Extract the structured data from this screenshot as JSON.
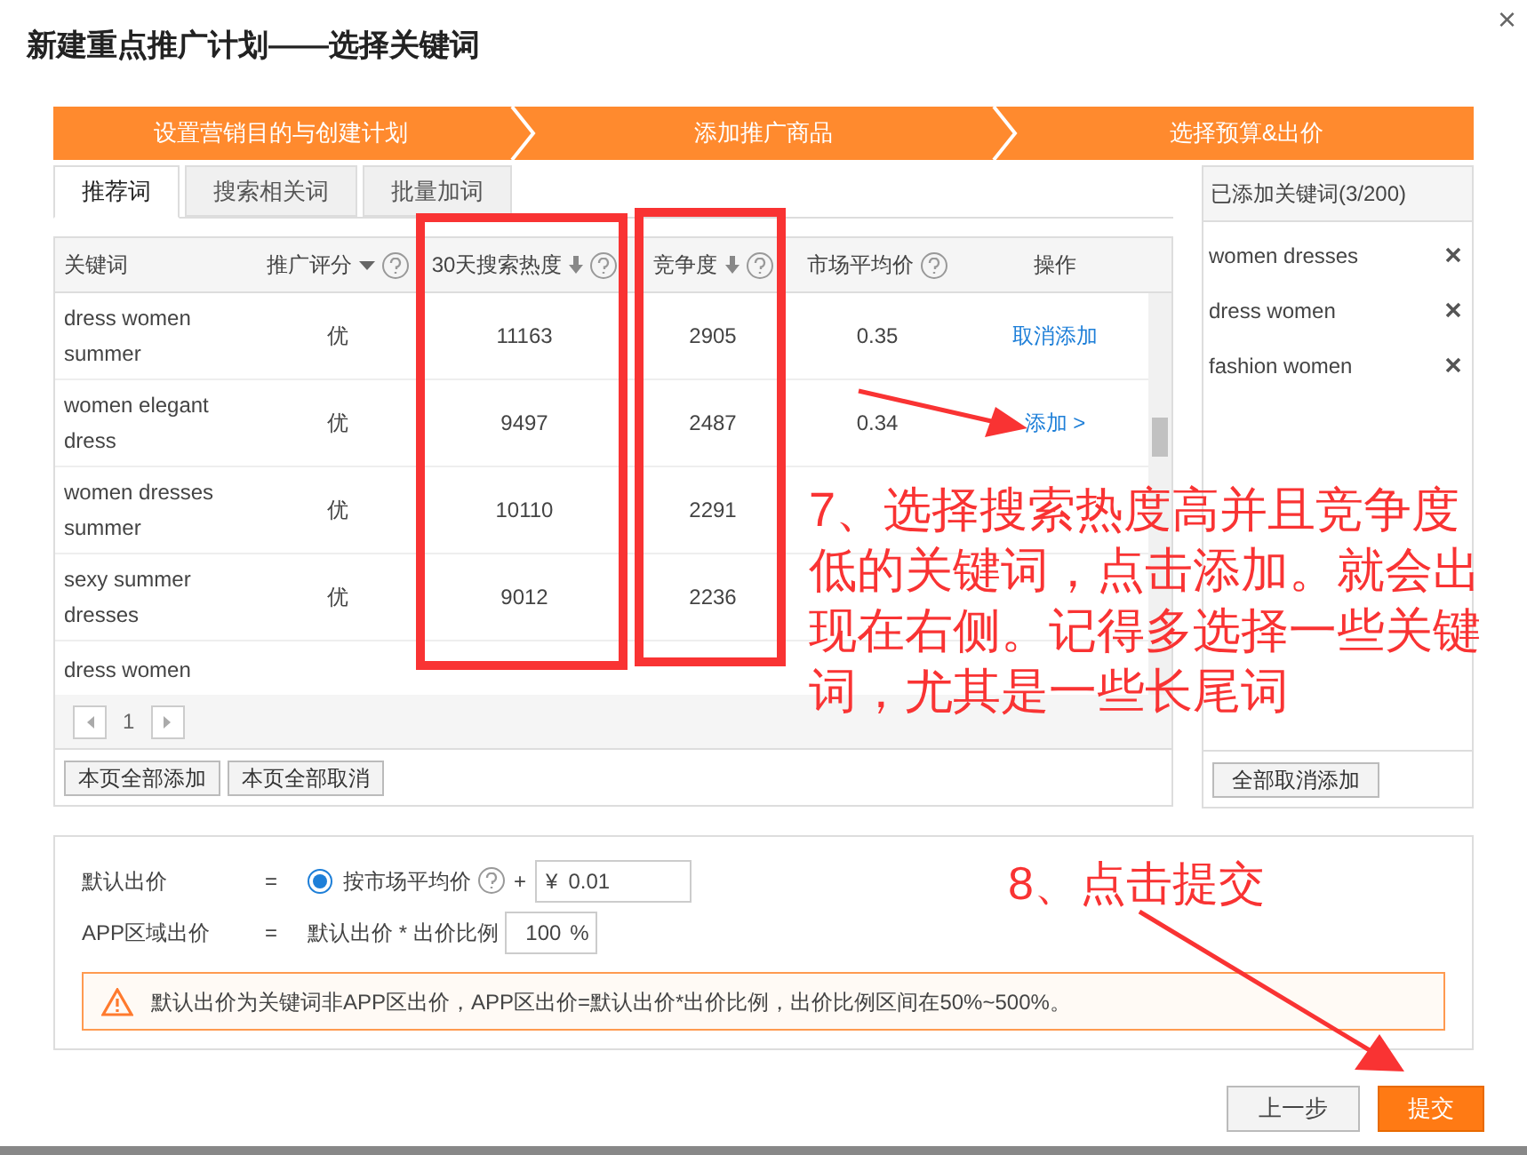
{
  "dialog": {
    "title": "新建重点推广计划——选择关键词",
    "close": "×"
  },
  "steps": [
    {
      "label": "设置营销目的与创建计划"
    },
    {
      "label": "添加推广商品"
    },
    {
      "label": "选择预算&出价"
    }
  ],
  "tabs": [
    {
      "label": "推荐词",
      "selected": true
    },
    {
      "label": "搜索相关词",
      "selected": false
    },
    {
      "label": "批量加词",
      "selected": false
    }
  ],
  "table": {
    "columns": [
      {
        "label": "关键词"
      },
      {
        "label": "推广评分",
        "filter": true,
        "help": true
      },
      {
        "label": "30天搜索热度",
        "sorted": true,
        "help": true
      },
      {
        "label": "竞争度",
        "sorted": true,
        "help": true
      },
      {
        "label": "市场平均价",
        "help": true
      },
      {
        "label": "操作"
      }
    ],
    "rows": [
      {
        "keyword": "dress women summer",
        "score": "优",
        "heat": "11163",
        "competition": "2905",
        "price": "0.35",
        "action": "取消添加"
      },
      {
        "keyword": "women elegant dress",
        "score": "优",
        "heat": "9497",
        "competition": "2487",
        "price": "0.34",
        "action": "添加 >"
      },
      {
        "keyword": "women dresses summer",
        "score": "优",
        "heat": "10110",
        "competition": "2291"
      },
      {
        "keyword": "sexy summer dresses",
        "score": "优",
        "heat": "9012",
        "competition": "2236"
      },
      {
        "keyword": "dress women"
      }
    ],
    "page": "1",
    "buttons": [
      "本页全部添加",
      "本页全部取消"
    ]
  },
  "added": {
    "title": "已添加关键词(3/200)",
    "items": [
      "women dresses",
      "dress women",
      "fashion women"
    ],
    "button": "全部取消添加"
  },
  "bid": {
    "rows": [
      {
        "kind": "radio",
        "label": "默认出价",
        "eq": "=",
        "option": "按市场平均价",
        "selected": true,
        "plus": "+",
        "currency": "¥",
        "value": "0.01"
      },
      {
        "kind": "ratio",
        "label": "APP区域出价",
        "eq": "=",
        "formula": "默认出价 * 出价比例",
        "value": "100",
        "unit": "%"
      }
    ],
    "warning": "默认出价为关键词非APP区出价，APP区出价=默认出价*出价比例，出价比例区间在50%~500%。"
  },
  "footer": {
    "buttons": [
      {
        "label": "上一步",
        "kind": "secondary"
      },
      {
        "label": "提交",
        "kind": "primary"
      }
    ]
  },
  "annotations": [
    {
      "text": "7、选择搜索热度高并且竞争度低的关键词，点击添加。就会出现在右侧。记得多选择一些关键词，尤其是一些长尾词"
    },
    {
      "text": "8、点击提交"
    }
  ]
}
